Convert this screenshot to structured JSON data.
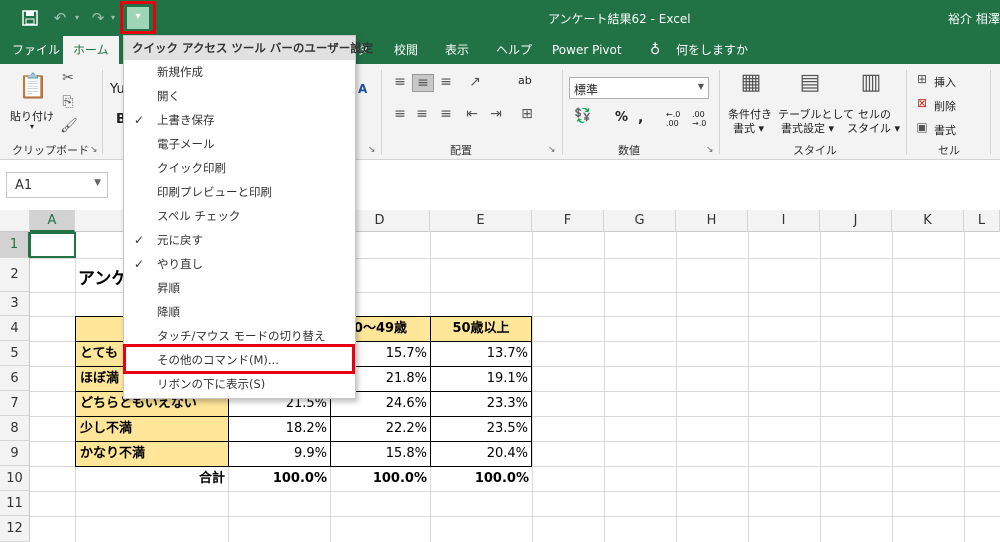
{
  "window": {
    "title": "アンケート結果62  -  Excel",
    "user": "裕介 相澤"
  },
  "qat": {
    "save_icon": "save-icon",
    "undo_icon": "undo-icon",
    "redo_icon": "redo-icon",
    "customize_icon": "customize-qat-icon"
  },
  "tabs": [
    "ファイル",
    "ホーム",
    "タ",
    "校閲",
    "表示",
    "ヘルプ",
    "Power Pivot",
    "何をしますか"
  ],
  "tell_me_icon": "lightbulb-icon",
  "ribbon": {
    "clipboard": {
      "paste_label": "貼り付け",
      "group_label": "クリップボード"
    },
    "font_partial": "Yu",
    "bold": "B",
    "alignment": {
      "group_label": "配置",
      "wrap_label": "ab"
    },
    "number": {
      "format_value": "標準",
      "group_label": "数値"
    },
    "styles": {
      "conditional_label_1": "条件付き",
      "conditional_label_2": "書式 ▾",
      "table_label_1": "テーブルとして",
      "table_label_2": "書式設定 ▾",
      "cell_style_label_1": "セルの",
      "cell_style_label_2": "スタイル ▾",
      "group_label": "スタイル"
    },
    "cells": {
      "insert": "挿入",
      "delete": "削除",
      "format": "書式",
      "group_label": "セル"
    }
  },
  "name_box": "A1",
  "columns": [
    "A",
    "B",
    "C",
    "D",
    "E",
    "F",
    "G",
    "H",
    "I",
    "J",
    "K",
    "L"
  ],
  "rows": [
    "1",
    "2",
    "3",
    "4",
    "5",
    "6",
    "7",
    "8",
    "9",
    "10",
    "11",
    "12"
  ],
  "sheet": {
    "title_partial": "アンケ",
    "header_d": "0～49歳",
    "header_e": "50歳以上",
    "labels": [
      "とても",
      "ほぼ満",
      "どちらともいえない",
      "少し不満",
      "かなり不満"
    ],
    "total_label": "合計",
    "col_c": [
      "21.5%",
      "18.2%",
      "9.9%",
      "100.0%"
    ],
    "col_d": [
      "15.7%",
      "21.8%",
      "24.6%",
      "22.2%",
      "15.8%",
      "100.0%"
    ],
    "col_e": [
      "13.7%",
      "19.1%",
      "23.3%",
      "23.5%",
      "20.4%",
      "100.0%"
    ]
  },
  "qat_menu": {
    "header": "クイック アクセス ツール バーのユーザー設定",
    "items": [
      {
        "label": "新規作成",
        "checked": false
      },
      {
        "label": "開く",
        "checked": false
      },
      {
        "label": "上書き保存",
        "checked": true
      },
      {
        "label": "電子メール",
        "checked": false
      },
      {
        "label": "クイック印刷",
        "checked": false
      },
      {
        "label": "印刷プレビューと印刷",
        "checked": false
      },
      {
        "label": "スペル チェック",
        "checked": false
      },
      {
        "label": "元に戻す",
        "checked": true
      },
      {
        "label": "やり直し",
        "checked": true
      },
      {
        "label": "昇順",
        "checked": false
      },
      {
        "label": "降順",
        "checked": false
      },
      {
        "label": "タッチ/マウス モードの切り替え",
        "checked": false
      },
      {
        "label": "その他のコマンド(M)...",
        "checked": false
      },
      {
        "label": "リボンの下に表示(S)",
        "checked": false
      }
    ],
    "check_mark": "✓"
  },
  "colors": {
    "excel_green": "#217346",
    "highlight_red": "#e60012",
    "header_yellow": "#ffe699"
  }
}
